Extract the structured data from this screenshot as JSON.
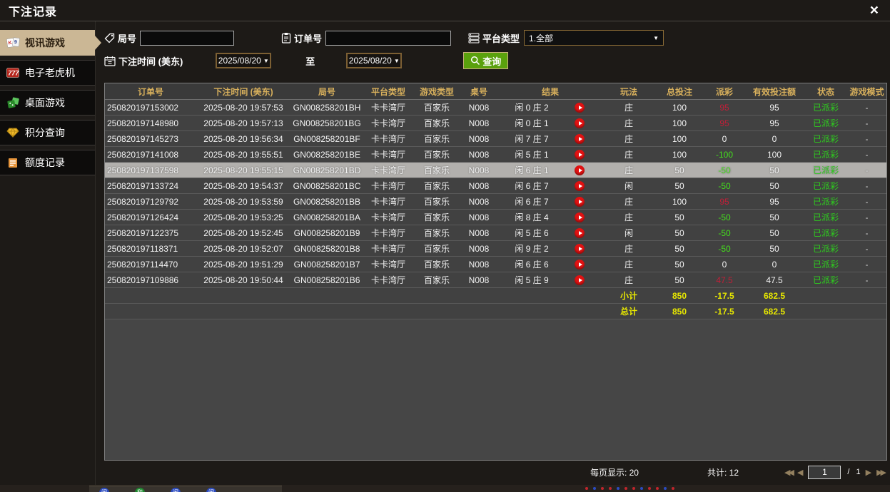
{
  "window": {
    "title": "下注记录",
    "close_glyph": "×"
  },
  "sidebar": {
    "items": [
      {
        "label": "视讯游戏",
        "icon": "video-cards-icon",
        "active": true
      },
      {
        "label": "电子老虎机",
        "icon": "slots-777-icon",
        "active": false
      },
      {
        "label": "桌面游戏",
        "icon": "table-games-icon",
        "active": false
      },
      {
        "label": "积分查询",
        "icon": "points-diamond-icon",
        "active": false
      },
      {
        "label": "额度记录",
        "icon": "quota-doc-icon",
        "active": false
      }
    ]
  },
  "filters": {
    "round_label": "局号",
    "round_value": "",
    "order_label": "订单号",
    "order_value": "",
    "platform_label": "平台类型",
    "platform_value": "1.全部",
    "time_label": "下注时间 (美东)",
    "date_from": "2025/08/20",
    "to_label": "至",
    "date_to": "2025/08/20",
    "query_label": "查询",
    "dropdown_arrow": "▼"
  },
  "icons": {
    "filters": [
      "tag-icon",
      "clipboard-icon",
      "platform-list-icon",
      "calendar-icon",
      "magnifier-icon"
    ],
    "row_action": "replay-play-icon",
    "pager": [
      "first-page-icon",
      "prev-page-icon",
      "next-page-icon",
      "last-page-icon"
    ]
  },
  "colors": {
    "accent_gold": "#d8b05c",
    "active_tab_bg": "#cbb795",
    "query_green": "#5aa10d",
    "payout_positive_red": "#c01f38",
    "payout_negative_green": "#44e01c",
    "status_green": "#2ecc1e",
    "summary_yellow": "#e8e800",
    "selected_row_bg": "#b2b0ad"
  },
  "table": {
    "headers": [
      "订单号",
      "下注时间 (美东)",
      "局号",
      "平台类型",
      "游戏类型",
      "桌号",
      "结果",
      "玩法",
      "总投注",
      "派彩",
      "有效投注额",
      "状态",
      "游戏模式"
    ],
    "rows": [
      {
        "order": "250820197153002",
        "time": "2025-08-20 19:57:53",
        "round": "GN008258201BH",
        "platform": "卡卡湾厅",
        "game_type": "百家乐",
        "table_no": "N008",
        "result": "闲 0 庄 2",
        "play": "庄",
        "total_bet": "100",
        "payout": "95",
        "valid_bet": "95",
        "status": "已派彩",
        "mode": "-",
        "selected": false
      },
      {
        "order": "250820197148980",
        "time": "2025-08-20 19:57:13",
        "round": "GN008258201BG",
        "platform": "卡卡湾厅",
        "game_type": "百家乐",
        "table_no": "N008",
        "result": "闲 0 庄 1",
        "play": "庄",
        "total_bet": "100",
        "payout": "95",
        "valid_bet": "95",
        "status": "已派彩",
        "mode": "-",
        "selected": false
      },
      {
        "order": "250820197145273",
        "time": "2025-08-20 19:56:34",
        "round": "GN008258201BF",
        "platform": "卡卡湾厅",
        "game_type": "百家乐",
        "table_no": "N008",
        "result": "闲 7 庄 7",
        "play": "庄",
        "total_bet": "100",
        "payout": "0",
        "valid_bet": "0",
        "status": "已派彩",
        "mode": "-",
        "selected": false
      },
      {
        "order": "250820197141008",
        "time": "2025-08-20 19:55:51",
        "round": "GN008258201BE",
        "platform": "卡卡湾厅",
        "game_type": "百家乐",
        "table_no": "N008",
        "result": "闲 5 庄 1",
        "play": "庄",
        "total_bet": "100",
        "payout": "-100",
        "valid_bet": "100",
        "status": "已派彩",
        "mode": "-",
        "selected": false
      },
      {
        "order": "250820197137598",
        "time": "2025-08-20 19:55:15",
        "round": "GN008258201BD",
        "platform": "卡卡湾厅",
        "game_type": "百家乐",
        "table_no": "N008",
        "result": "闲 6 庄 1",
        "play": "庄",
        "total_bet": "50",
        "payout": "-50",
        "valid_bet": "50",
        "status": "已派彩",
        "mode": "-",
        "selected": true
      },
      {
        "order": "250820197133724",
        "time": "2025-08-20 19:54:37",
        "round": "GN008258201BC",
        "platform": "卡卡湾厅",
        "game_type": "百家乐",
        "table_no": "N008",
        "result": "闲 6 庄 7",
        "play": "闲",
        "total_bet": "50",
        "payout": "-50",
        "valid_bet": "50",
        "status": "已派彩",
        "mode": "-",
        "selected": false
      },
      {
        "order": "250820197129792",
        "time": "2025-08-20 19:53:59",
        "round": "GN008258201BB",
        "platform": "卡卡湾厅",
        "game_type": "百家乐",
        "table_no": "N008",
        "result": "闲 6 庄 7",
        "play": "庄",
        "total_bet": "100",
        "payout": "95",
        "valid_bet": "95",
        "status": "已派彩",
        "mode": "-",
        "selected": false
      },
      {
        "order": "250820197126424",
        "time": "2025-08-20 19:53:25",
        "round": "GN008258201BA",
        "platform": "卡卡湾厅",
        "game_type": "百家乐",
        "table_no": "N008",
        "result": "闲 8 庄 4",
        "play": "庄",
        "total_bet": "50",
        "payout": "-50",
        "valid_bet": "50",
        "status": "已派彩",
        "mode": "-",
        "selected": false
      },
      {
        "order": "250820197122375",
        "time": "2025-08-20 19:52:45",
        "round": "GN008258201B9",
        "platform": "卡卡湾厅",
        "game_type": "百家乐",
        "table_no": "N008",
        "result": "闲 5 庄 6",
        "play": "闲",
        "total_bet": "50",
        "payout": "-50",
        "valid_bet": "50",
        "status": "已派彩",
        "mode": "-",
        "selected": false
      },
      {
        "order": "250820197118371",
        "time": "2025-08-20 19:52:07",
        "round": "GN008258201B8",
        "platform": "卡卡湾厅",
        "game_type": "百家乐",
        "table_no": "N008",
        "result": "闲 9 庄 2",
        "play": "庄",
        "total_bet": "50",
        "payout": "-50",
        "valid_bet": "50",
        "status": "已派彩",
        "mode": "-",
        "selected": false
      },
      {
        "order": "250820197114470",
        "time": "2025-08-20 19:51:29",
        "round": "GN008258201B7",
        "platform": "卡卡湾厅",
        "game_type": "百家乐",
        "table_no": "N008",
        "result": "闲 6 庄 6",
        "play": "庄",
        "total_bet": "50",
        "payout": "0",
        "valid_bet": "0",
        "status": "已派彩",
        "mode": "-",
        "selected": false
      },
      {
        "order": "250820197109886",
        "time": "2025-08-20 19:50:44",
        "round": "GN008258201B6",
        "platform": "卡卡湾厅",
        "game_type": "百家乐",
        "table_no": "N008",
        "result": "闲 5 庄 9",
        "play": "庄",
        "total_bet": "50",
        "payout": "47.5",
        "valid_bet": "47.5",
        "status": "已派彩",
        "mode": "-",
        "selected": false
      }
    ],
    "subtotal": {
      "label": "小计",
      "total_bet": "850",
      "payout": "-17.5",
      "valid_bet": "682.5"
    },
    "grand_total": {
      "label": "总计",
      "total_bet": "850",
      "payout": "-17.5",
      "valid_bet": "682.5"
    }
  },
  "footer": {
    "page_size_label": "每页显示: 20",
    "total_label": "共计: 12",
    "page_value": "1",
    "page_separator": "/",
    "page_total": "1"
  }
}
